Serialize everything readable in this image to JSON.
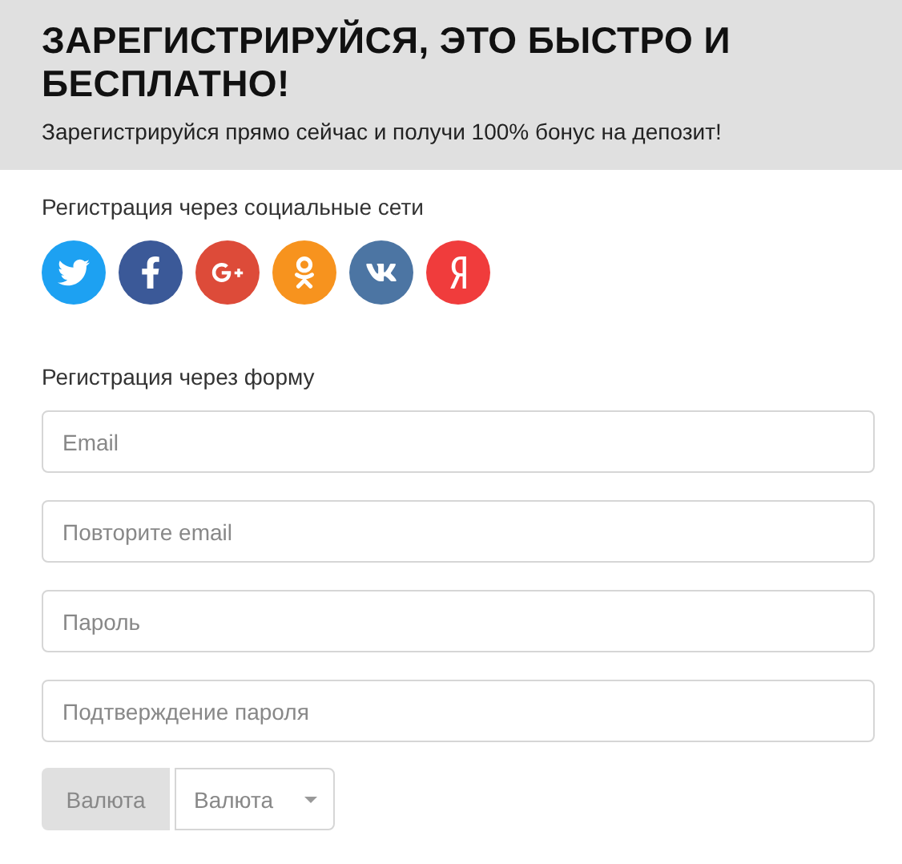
{
  "header": {
    "title": "ЗАРЕГИСТРИРУЙСЯ, ЭТО БЫСТРО И БЕСПЛАТНО!",
    "subtitle": "Зарегистрируйся прямо сейчас и получи 100% бонус на депозит!"
  },
  "social": {
    "label": "Регистрация через социальные сети",
    "buttons": [
      {
        "kind": "twitter",
        "color": "#1da1f2"
      },
      {
        "kind": "facebook",
        "color": "#3b5998"
      },
      {
        "kind": "googleplus",
        "color": "#dd4b39"
      },
      {
        "kind": "odnoklassniki",
        "color": "#f7931e"
      },
      {
        "kind": "vk",
        "color": "#4c75a3"
      },
      {
        "kind": "yandex",
        "color": "#f03c3c"
      }
    ]
  },
  "form": {
    "label": "Регистрация через форму",
    "fields": [
      {
        "placeholder": "Email"
      },
      {
        "placeholder": "Повторите email"
      },
      {
        "placeholder": "Пароль"
      },
      {
        "placeholder": "Подтверждение пароля"
      }
    ],
    "currency": {
      "addon": "Валюта",
      "select": "Валюта"
    }
  }
}
